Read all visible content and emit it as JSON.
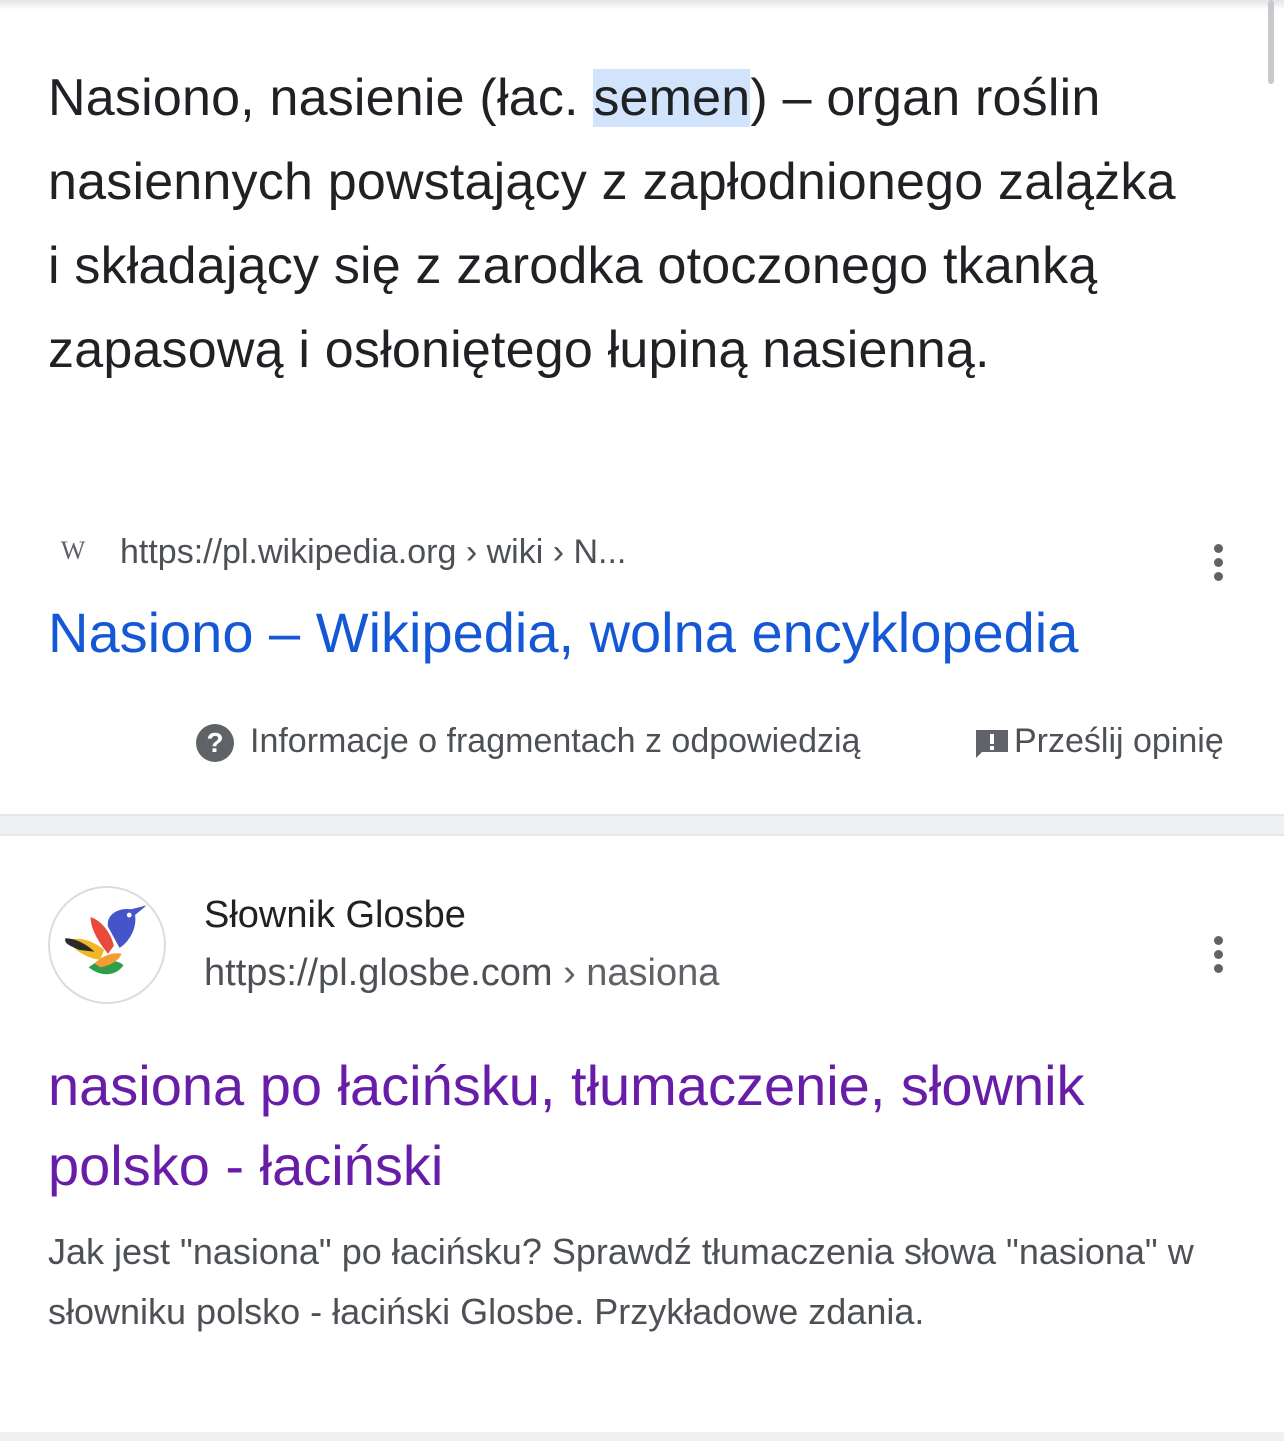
{
  "featured_snippet": {
    "text_before": "Nasiono, nasienie (łac. ",
    "highlight": "semen",
    "text_after": ") – organ roślin nasiennych powstający z zapłodnionego zalążka i składający się z zarodka otoczonego tkanką zapasową i osłoniętego łupiną nasienną."
  },
  "wiki_source": {
    "icon_letter": "W",
    "url": "https://pl.wikipedia.org › wiki › N...",
    "title": "Nasiono – Wikipedia, wolna encyklopedia"
  },
  "snippet_footer": {
    "about_label": "Informacje o fragmentach z odpowiedzią",
    "about_icon": "?",
    "feedback_label": "Prześlij opinię",
    "feedback_icon_glyph": "!"
  },
  "result": {
    "site_name": "Słownik Glosbe",
    "site_url_domain": "https://pl.glosbe.com",
    "site_url_path": " › nasiona",
    "title": "nasiona po łacińsku, tłumaczenie, słownik polsko - łaciński",
    "description": "Jak jest \"nasiona\" po łacińsku? Sprawdź tłumaczenia słowa \"nasiona\" w słowniku polsko - łaciński Glosbe. Przykładowe zdania."
  },
  "colors": {
    "link_blue": "#1558d6",
    "visited_purple": "#681da8",
    "highlight": "#d2e3fc",
    "text_dark": "#202124",
    "text_grey": "#4d5156"
  }
}
